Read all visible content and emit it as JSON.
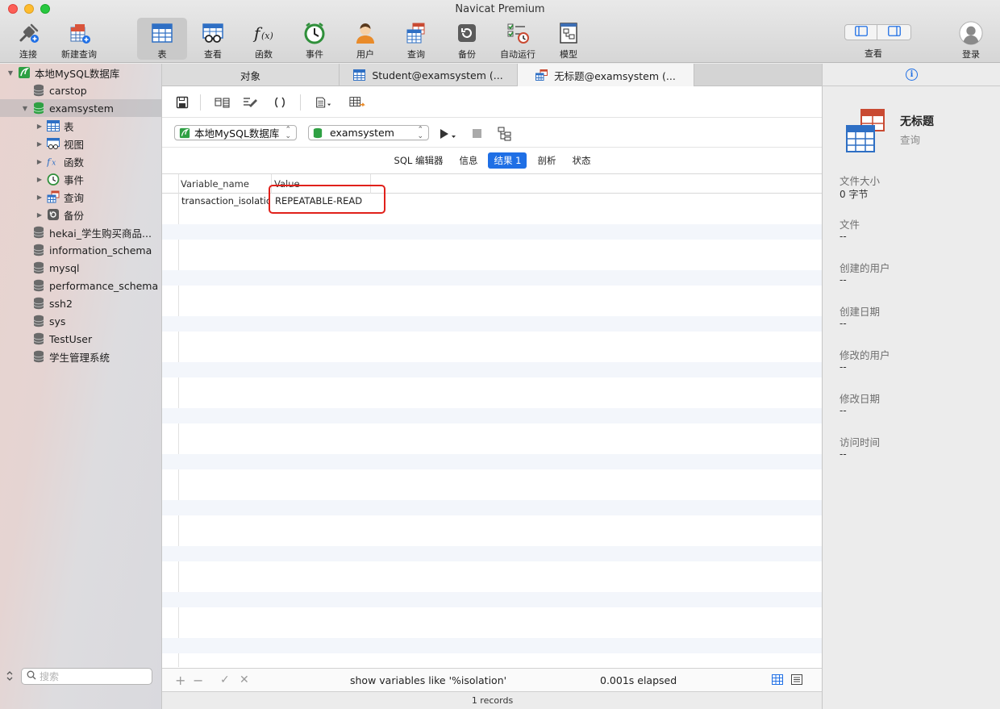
{
  "window": {
    "title": "Navicat Premium"
  },
  "toolbar": {
    "left": [
      {
        "label": "连接",
        "icon": "connection-plug-icon"
      },
      {
        "label": "新建查询",
        "icon": "new-query-icon"
      }
    ],
    "main": [
      {
        "label": "表",
        "icon": "table-icon",
        "active": true
      },
      {
        "label": "查看",
        "icon": "view-icon"
      },
      {
        "label": "函数",
        "icon": "function-icon"
      },
      {
        "label": "事件",
        "icon": "event-clock-icon"
      },
      {
        "label": "用户",
        "icon": "user-icon"
      },
      {
        "label": "查询",
        "icon": "query-icon"
      },
      {
        "label": "备份",
        "icon": "backup-icon"
      },
      {
        "label": "自动运行",
        "icon": "automation-icon"
      },
      {
        "label": "模型",
        "icon": "model-icon"
      }
    ],
    "view_label": "查看",
    "login_label": "登录"
  },
  "sidebar": {
    "connection": "本地MySQL数据库",
    "databases": [
      "carstop",
      "examsystem",
      "hekai_学生购买商品...",
      "information_schema",
      "mysql",
      "performance_schema",
      "ssh2",
      "sys",
      "TestUser",
      "学生管理系统"
    ],
    "objects": [
      "表",
      "视图",
      "函数",
      "事件",
      "查询",
      "备份"
    ],
    "search_placeholder": "搜索"
  },
  "tabs": [
    {
      "label": "对象"
    },
    {
      "label": "Student@examsystem (..."
    },
    {
      "label": "无标题@examsystem (..."
    }
  ],
  "editor": {
    "connection_select": "本地MySQL数据库",
    "database_select": "examsystem",
    "result_tabs": [
      "SQL 编辑器",
      "信息",
      "结果 1",
      "剖析",
      "状态"
    ],
    "active_result_tab": "结果 1"
  },
  "grid": {
    "columns": [
      "Variable_name",
      "Value"
    ],
    "rows": [
      [
        "transaction_isolation",
        "REPEATABLE-READ"
      ]
    ]
  },
  "footer": {
    "query": "show variables like '%isolation'",
    "elapsed": "0.001s elapsed",
    "records": "1 records"
  },
  "info_panel": {
    "title": "无标题",
    "subtitle": "查询",
    "fields": [
      {
        "label": "文件大小",
        "value": "0 字节"
      },
      {
        "label": "文件",
        "value": "--"
      },
      {
        "label": "创建的用户",
        "value": "--"
      },
      {
        "label": "创建日期",
        "value": "--"
      },
      {
        "label": "修改的用户",
        "value": "--"
      },
      {
        "label": "修改日期",
        "value": "--"
      },
      {
        "label": "访问时间",
        "value": "--"
      }
    ]
  },
  "colors": {
    "accent": "#1f6fe5",
    "highlight": "#e0211b",
    "db_green": "#2ea043"
  }
}
